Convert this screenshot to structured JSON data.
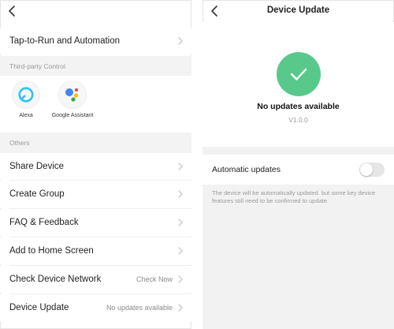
{
  "left_panel": {
    "tap_to_run": "Tap-to-Run and Automation",
    "third_party_header": "Third-party Control",
    "third_party_items": [
      {
        "label": "Alexa",
        "icon": "alexa-icon"
      },
      {
        "label": "Google Assistant",
        "icon": "google-assistant-icon"
      }
    ],
    "others_header": "Others",
    "menu": [
      {
        "label": "Share Device",
        "value": ""
      },
      {
        "label": "Create Group",
        "value": ""
      },
      {
        "label": "FAQ & Feedback",
        "value": ""
      },
      {
        "label": "Add to Home Screen",
        "value": ""
      },
      {
        "label": "Check Device Network",
        "value": "Check Now"
      },
      {
        "label": "Device Update",
        "value": "No updates available"
      }
    ]
  },
  "right_panel": {
    "title": "Device Update",
    "status": "No updates available",
    "version": "V1.0.0",
    "auto_updates_label": "Automatic updates",
    "auto_updates_enabled": false,
    "note": "The device will be automatically updated. but some key device features still need to be confirmed to update.",
    "accent_color": "#58c98b"
  }
}
